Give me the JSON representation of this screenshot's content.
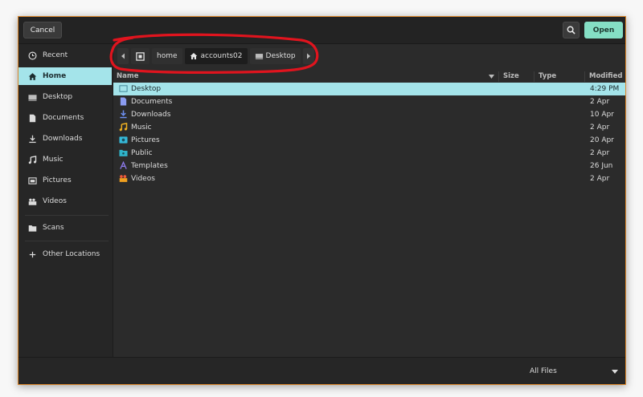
{
  "header": {
    "cancel_label": "Cancel",
    "open_label": "Open"
  },
  "sidebar": {
    "items": [
      {
        "label": "Recent",
        "icon": "clock-icon"
      },
      {
        "label": "Home",
        "icon": "home-icon"
      },
      {
        "label": "Desktop",
        "icon": "desktop-icon"
      },
      {
        "label": "Documents",
        "icon": "document-icon"
      },
      {
        "label": "Downloads",
        "icon": "download-icon"
      },
      {
        "label": "Music",
        "icon": "music-icon"
      },
      {
        "label": "Pictures",
        "icon": "picture-icon"
      },
      {
        "label": "Videos",
        "icon": "video-icon"
      },
      {
        "label": "Scans",
        "icon": "folder-icon"
      },
      {
        "label": "Other Locations",
        "icon": "plus-icon"
      }
    ]
  },
  "pathbar": {
    "crumbs": [
      {
        "label": "home"
      },
      {
        "label": "accounts02",
        "icon": "home-icon"
      },
      {
        "label": "Desktop",
        "icon": "desktop-icon"
      }
    ]
  },
  "columns": {
    "name": "Name",
    "size": "Size",
    "type": "Type",
    "modified": "Modified"
  },
  "files": [
    {
      "name": "Desktop",
      "modified": "4:29 PM",
      "icon": "desktop-icon",
      "color": "#7ec8e3"
    },
    {
      "name": "Documents",
      "modified": "2 Apr",
      "icon": "document-icon",
      "color": "#8b9cf0"
    },
    {
      "name": "Downloads",
      "modified": "10 Apr",
      "icon": "download-icon",
      "color": "#6d8ff0"
    },
    {
      "name": "Music",
      "modified": "2 Apr",
      "icon": "music-icon",
      "color": "#f0b020"
    },
    {
      "name": "Pictures",
      "modified": "20 Apr",
      "icon": "picture-icon",
      "color": "#35b8d8"
    },
    {
      "name": "Public",
      "modified": "2 Apr",
      "icon": "public-icon",
      "color": "#2fb3c9"
    },
    {
      "name": "Templates",
      "modified": "26 Jun",
      "icon": "template-icon",
      "color": "#8f7cf0"
    },
    {
      "name": "Videos",
      "modified": "2 Apr",
      "icon": "video-icon",
      "color": "#f05a3a"
    }
  ],
  "footer": {
    "filter_label": "All Files"
  },
  "colors": {
    "accent": "#85dfc5",
    "selection": "#a4e4ea",
    "border": "#e08a2c",
    "annotation": "#e0141e"
  }
}
